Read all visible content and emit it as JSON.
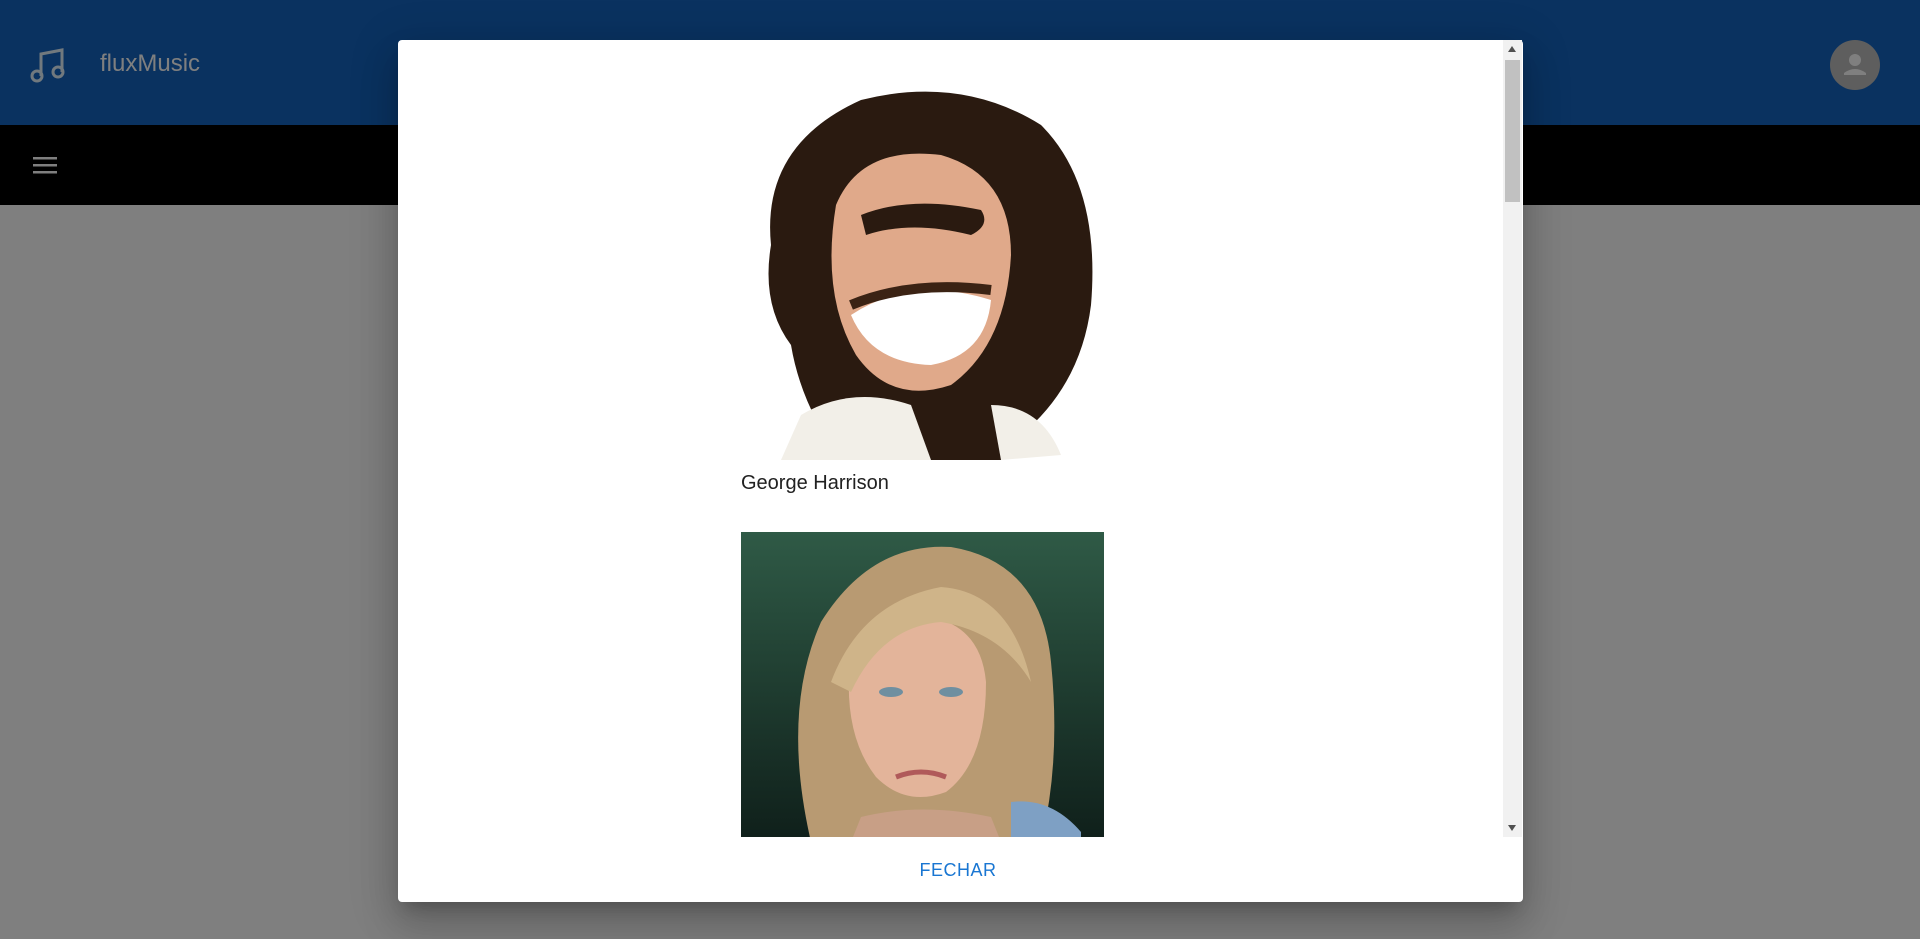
{
  "header": {
    "app_name": "fluxMusic",
    "logo_icon": "music-note-icon",
    "avatar_icon": "user-avatar-icon",
    "bar_color": "#1565c0"
  },
  "nav": {
    "menu_icon": "hamburger-menu-icon"
  },
  "dialog": {
    "artists": [
      {
        "name": "George Harrison"
      },
      {
        "name": ""
      }
    ],
    "close_label": "FECHAR",
    "accent_color": "#1976d2"
  }
}
